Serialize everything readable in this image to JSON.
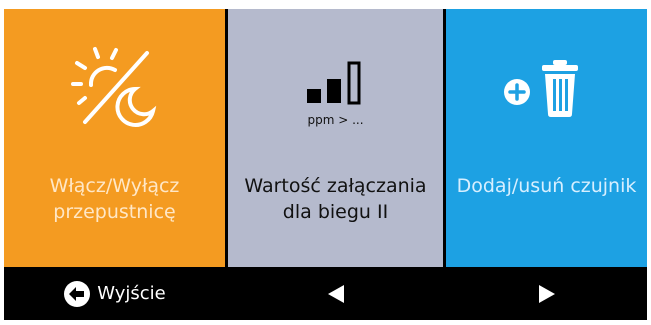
{
  "tiles": [
    {
      "label_lines": [
        "Włącz/Wyłącz",
        "przepustnicę"
      ],
      "icon": "sun-moon-icon",
      "color": "#f49b21"
    },
    {
      "label_lines": [
        "Wartość załączania",
        "dla biegu II"
      ],
      "icon": "signal-bars-icon",
      "sublabel": "ppm > ...",
      "color": "#b5bacd"
    },
    {
      "label_lines": [
        "Dodaj/usuń czujnik"
      ],
      "icon": "add-delete-icon",
      "color": "#1da1e3"
    }
  ],
  "nav": {
    "exit_label": "Wyjście",
    "exit_icon": "exit-icon",
    "prev_icon": "arrow-left-icon",
    "next_icon": "arrow-right-icon"
  }
}
